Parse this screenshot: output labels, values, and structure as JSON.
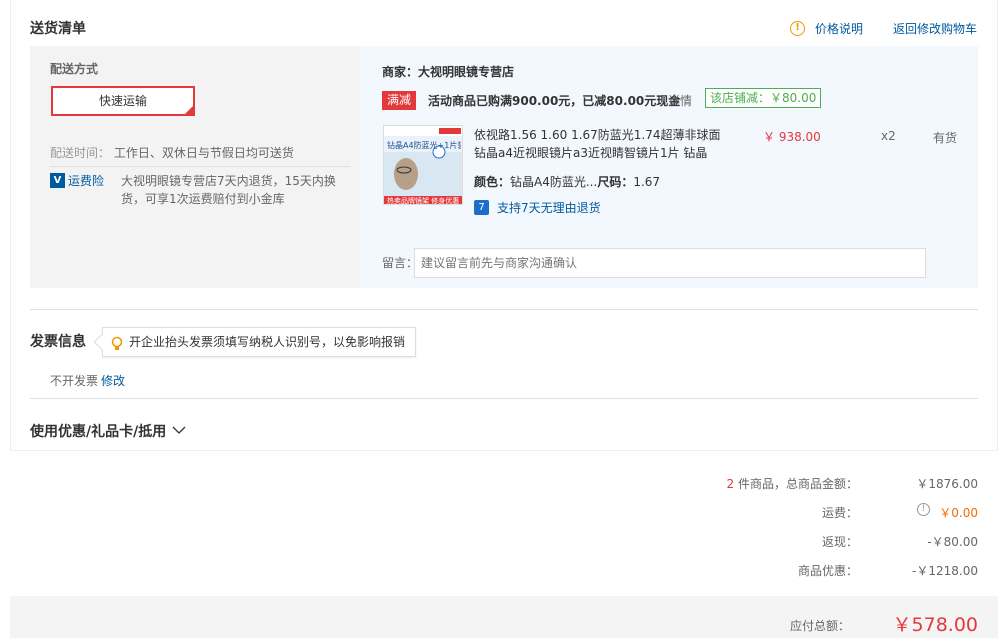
{
  "delivery": {
    "title": "送货清单",
    "price_note": "价格说明",
    "back_to_cart": "返回修改购物车",
    "method_label": "配送方式",
    "method_value": "快速运输",
    "time_label": "配送时间：",
    "time_value": "工作日、双休日与节假日均可送货",
    "insurance_link": "运费险",
    "insurance_text_line1": "大视明眼镜专营店7天内退货，15天内换",
    "insurance_text_line2": "货，可享1次运费赔付到小金库"
  },
  "shop": {
    "name": "商家：大视明眼镜专营店",
    "promo_badge": "满减",
    "promo_text": "活动商品已购满900.00元，已减80.00元现金",
    "promo_detail": "详情",
    "shop_discount": "该店铺减：￥80.00"
  },
  "product": {
    "title_line1": "依视路1.56 1.60 1.67防蓝光1.74超薄非球面",
    "title_line2": "钻晶a4近视眼镜片a3近视睛智镜片1片 钻晶",
    "attr_color_label": "颜色：",
    "attr_color_value": "钻晶A4防蓝光...",
    "attr_size_label": "尺码：",
    "attr_size_value": "1.67",
    "return_text": "支持7天无理由退货",
    "price": "￥ 938.00",
    "qty": "x2",
    "stock": "有货",
    "thumb_caption_top": "钻晶A4防蓝光+1片装",
    "thumb_caption_bottom": "热卖品牌镜架 修身优惠"
  },
  "message": {
    "label": "留言：",
    "placeholder": "建议留言前先与商家沟通确认"
  },
  "invoice": {
    "title": "发票信息",
    "tip": "开企业抬头发票须填写纳税人识别号，以免影响报销",
    "value": "不开发票",
    "edit": "修改"
  },
  "coupon": {
    "title": "使用优惠/礼品卡/抵用"
  },
  "summary": {
    "count": "2",
    "count_text": " 件商品，总商品金额：",
    "goods_total": "￥1876.00",
    "freight_label": "运费：",
    "freight_value": "￥0.00",
    "rebate_label": "返现：",
    "rebate_value": "-￥80.00",
    "discount_label": "商品优惠：",
    "discount_value": "-￥1218.00",
    "payable_label": "应付总额：",
    "payable_value": "￥578.00"
  },
  "colors": {
    "accent_red": "#e4393c",
    "link_blue": "#005aa0",
    "green": "#4cae4c",
    "orange": "#e4393c"
  }
}
